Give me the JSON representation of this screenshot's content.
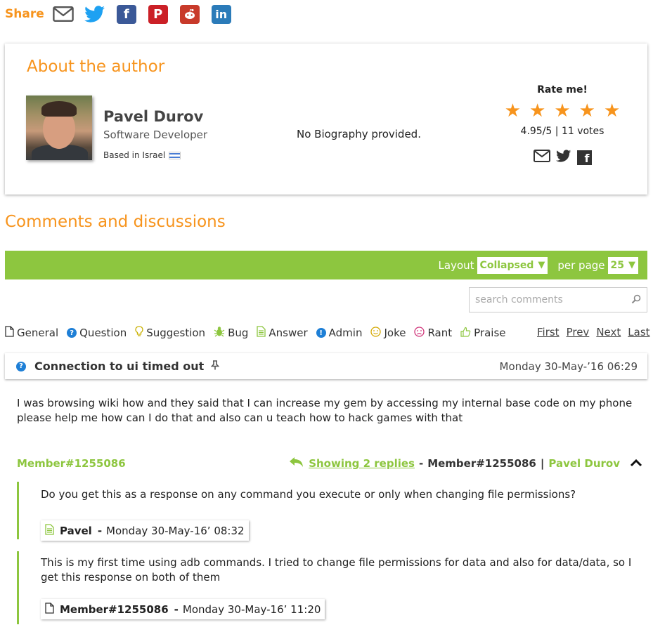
{
  "share": {
    "label": "Share",
    "icons": [
      "email-icon",
      "twitter-icon",
      "facebook-icon",
      "pinterest-icon",
      "reddit-icon",
      "linkedin-icon"
    ],
    "colors": {
      "label": "#f7941d",
      "twitter": "#1da1f2",
      "facebook": "#3b5998",
      "pinterest": "#cb2027",
      "reddit": "#c83a2a",
      "linkedin": "#2b7bb9"
    }
  },
  "author": {
    "heading": "About the author",
    "name": "Pavel Durov",
    "role": "Software Developer",
    "based": "Based in Israel",
    "bio": "No Biography provided.",
    "rate_title": "Rate me!",
    "rating": 4.95,
    "score_text": "4.95/5 | 11 votes"
  },
  "comments": {
    "heading": "Comments and discussions",
    "layout_label": "Layout",
    "layout_value": "Collapsed",
    "per_page_label": "per page",
    "per_page_value": "25",
    "search_placeholder": "search comments",
    "filters": [
      {
        "label": "General",
        "icon": "document-icon"
      },
      {
        "label": "Question",
        "icon": "question-icon"
      },
      {
        "label": "Suggestion",
        "icon": "lightbulb-icon"
      },
      {
        "label": "Bug",
        "icon": "bug-icon"
      },
      {
        "label": "Answer",
        "icon": "answer-icon"
      },
      {
        "label": "Admin",
        "icon": "admin-icon"
      },
      {
        "label": "Joke",
        "icon": "smile-icon"
      },
      {
        "label": "Rant",
        "icon": "angry-icon"
      },
      {
        "label": "Praise",
        "icon": "thumbs-up-icon"
      }
    ],
    "pager": {
      "first": "First",
      "prev": "Prev",
      "next": "Next",
      "last": "Last"
    },
    "accent": "#8dc63f"
  },
  "thread": {
    "title": "Connection to ui timed out",
    "date": "Monday 30-May-’16 06:29",
    "body": "I was browsing wiki how and they said that I can increase my gem by accessing my internal base code on my phone please help me how can I do that and also can u teach how to hack games with that",
    "member": "Member#1255086",
    "replies_link": "Showing 2 replies",
    "replies_sep": "-",
    "replies_member": "Member#1255086",
    "replies_pipe": "|",
    "replies_author": "Pavel Durov"
  },
  "replies": [
    {
      "text": "Do you get this as a response on any command you execute or only when changing file permissions?",
      "author": "Pavel",
      "dash": "-",
      "date": "Monday 30-May-16’ 08:32",
      "icon": "answer-icon"
    },
    {
      "text": "This is my first time using adb commands. I tried to change file permissions for data and also for data/data, so I get this response on both of them",
      "author": "Member#1255086",
      "dash": "-",
      "date": "Monday 30-May-16’ 11:20",
      "icon": "document-icon"
    }
  ]
}
